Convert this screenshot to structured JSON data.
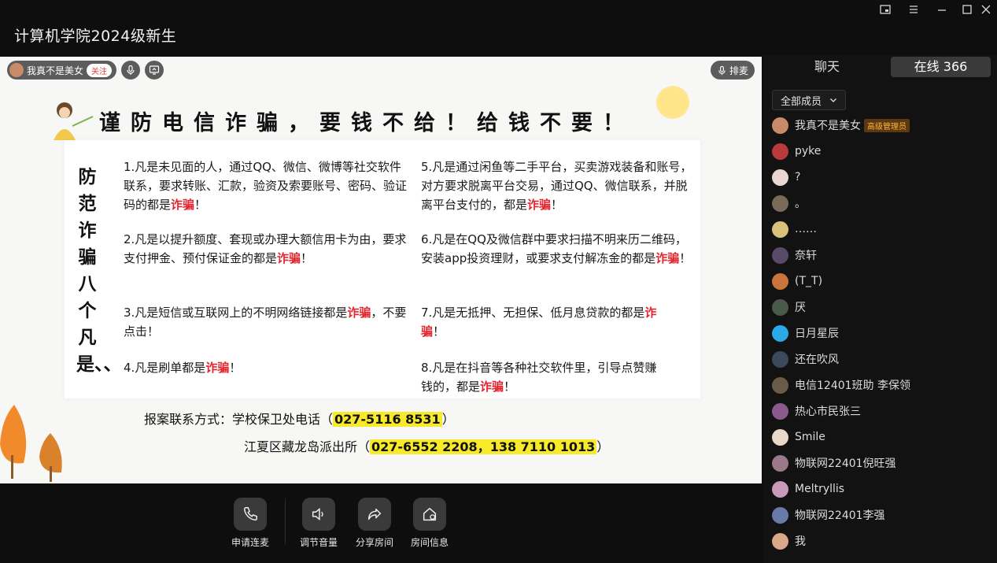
{
  "window": {
    "title": "计算机学院2024级新生"
  },
  "stage": {
    "host": {
      "name": "我真不是美女",
      "follow_label": "关注"
    },
    "queue_label": "排麦",
    "slide": {
      "headline": "谨防电信诈骗，要钱不给！给钱不要！",
      "vertical_title": "防范诈骗八个凡是、、",
      "rules": [
        {
          "pre": "1.凡是未见面的人，通过QQ、微信、微博等社交软件联系，要求转账、汇款，验资及索要账号、密码、验证码的都是",
          "red": "诈骗",
          "post": "！"
        },
        {
          "pre": "2.凡是以提升额度、套现或办理大额信用卡为由，要求支付押金、预付保证金的都是",
          "red": "诈骗",
          "post": "！"
        },
        {
          "pre": "3.凡是短信或互联网上的不明网络链接都是",
          "red": "诈骗",
          "post": "，不要点击！"
        },
        {
          "pre": "4.凡是刷单都是",
          "red": "诈骗",
          "post": "！"
        },
        {
          "pre": "5.凡是通过闲鱼等二手平台，买卖游戏装备和账号，对方要求脱离平台交易，通过QQ、微信联系，并脱离平台支付的，都是",
          "red": "诈骗",
          "post": "！"
        },
        {
          "pre": "6.凡是在QQ及微信群中要求扫描不明来历二维码，安装app投资理财，或要求支付解冻金的都是",
          "red": "诈骗",
          "post": "！"
        },
        {
          "pre": "7.凡是无抵押、无担保、低月息贷款的都是",
          "red": "诈骗",
          "post": "！"
        },
        {
          "pre": "8.凡是在抖音等各种社交软件里，引导点赞赚钱的，都是",
          "red": "诈骗",
          "post": "！"
        }
      ],
      "contact1": {
        "label": "报案联系方式：学校保卫处电话（",
        "number": "027-5116 8531",
        "close": "）"
      },
      "contact2": {
        "label": "江夏区藏龙岛派出所（",
        "number": "027-6552 2208，138 7110 1013",
        "close": "）"
      }
    }
  },
  "controls": [
    {
      "label": "申请连麦",
      "icon": "phone-icon"
    },
    {
      "label": "调节音量",
      "icon": "speaker-icon"
    },
    {
      "label": "分享房间",
      "icon": "share-icon"
    },
    {
      "label": "房间信息",
      "icon": "room-info-icon"
    }
  ],
  "sidebar": {
    "tab_chat": "聊天",
    "tab_online": "在线 366",
    "filter_label": "全部成员",
    "members": [
      {
        "name": "我真不是美女",
        "badge": "高级管理员",
        "color": "#c98a6a"
      },
      {
        "name": "pyke",
        "color": "#b83a3a"
      },
      {
        "name": "?",
        "color": "#e9d6d2"
      },
      {
        "name": "。",
        "color": "#7a6a58"
      },
      {
        "name": "……",
        "color": "#d8c27a"
      },
      {
        "name": "奈轩",
        "color": "#5a4a6a"
      },
      {
        "name": "(T_T)",
        "color": "#c8743a"
      },
      {
        "name": "厌",
        "color": "#4a5a48"
      },
      {
        "name": "日月星辰",
        "color": "#2aa8e8"
      },
      {
        "name": "还在吹风",
        "color": "#3a4a5a"
      },
      {
        "name": "电信12401班助 李保领",
        "color": "#6a5a48"
      },
      {
        "name": "热心市民张三",
        "color": "#8a5a8a"
      },
      {
        "name": "Smile",
        "color": "#e8d8c8"
      },
      {
        "name": "物联网22401倪旺强",
        "color": "#9a7a8a"
      },
      {
        "name": "Meltryllis",
        "color": "#c89aba"
      },
      {
        "name": "物联网22401李强",
        "color": "#6a7aa8"
      },
      {
        "name": "我",
        "color": "#d8a888"
      }
    ]
  }
}
